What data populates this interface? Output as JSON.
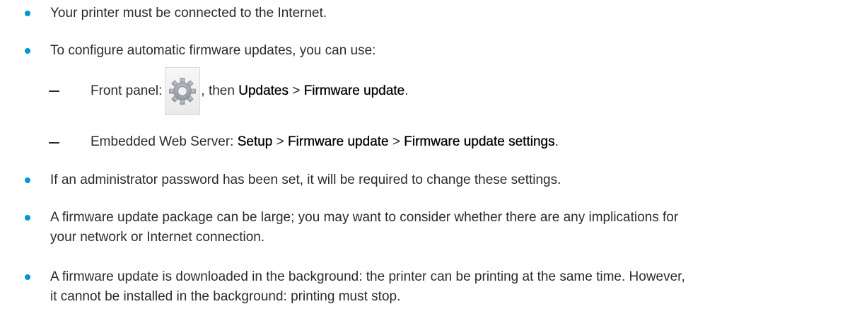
{
  "colors": {
    "bullet": "#0096d6",
    "text": "#2b2b2b"
  },
  "bullets": [
    {
      "text": "Your printer must be connected to the Internet."
    },
    {
      "text": "To configure automatic firmware updates, you can use:"
    },
    {
      "text": "If an administrator password has been set, it will be required to change these settings."
    },
    {
      "line1": "A firmware update package can be large; you may want to consider whether there are any implications for",
      "line2": "your network or Internet connection."
    },
    {
      "line1": "A firmware update is downloaded in the background: the printer can be printing at the same time. However,",
      "line2": "it cannot be installed in the background: printing must stop."
    }
  ],
  "sub_items": {
    "front_panel": {
      "prefix": "Front panel:",
      "icon": "settings-gear-icon",
      "after_icon": ", then",
      "menu1": "Updates",
      "separator": ">",
      "menu2": "Firmware update",
      "suffix": "."
    },
    "ews": {
      "prefix": "Embedded Web Server:",
      "menu1": "Setup",
      "separator1": ">",
      "menu2": "Firmware update",
      "separator2": ">",
      "menu3": "Firmware update settings",
      "suffix": "."
    }
  }
}
